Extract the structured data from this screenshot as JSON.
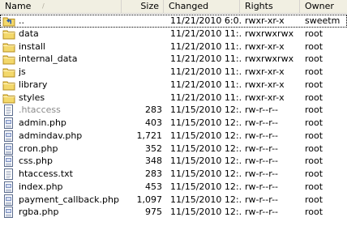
{
  "columns": {
    "name": "Name",
    "size": "Size",
    "changed": "Changed",
    "rights": "Rights",
    "owner": "Owner"
  },
  "sort_indicator": "/",
  "files": [
    {
      "name": "..",
      "size": "",
      "changed": "11/21/2010 6:0...",
      "rights": "rwxr-xr-x",
      "owner": "sweetm",
      "icon": "parent-folder-icon"
    },
    {
      "name": "data",
      "size": "",
      "changed": "11/21/2010 11:...",
      "rights": "rwxrwxrwx",
      "owner": "root",
      "icon": "folder-icon"
    },
    {
      "name": "install",
      "size": "",
      "changed": "11/21/2010 11:...",
      "rights": "rwxr-xr-x",
      "owner": "root",
      "icon": "folder-icon"
    },
    {
      "name": "internal_data",
      "size": "",
      "changed": "11/21/2010 11:...",
      "rights": "rwxrwxrwx",
      "owner": "root",
      "icon": "folder-icon"
    },
    {
      "name": "js",
      "size": "",
      "changed": "11/21/2010 11:...",
      "rights": "rwxr-xr-x",
      "owner": "root",
      "icon": "folder-icon"
    },
    {
      "name": "library",
      "size": "",
      "changed": "11/21/2010 11:...",
      "rights": "rwxr-xr-x",
      "owner": "root",
      "icon": "folder-icon"
    },
    {
      "name": "styles",
      "size": "",
      "changed": "11/21/2010 11:...",
      "rights": "rwxr-xr-x",
      "owner": "root",
      "icon": "folder-icon"
    },
    {
      "name": ".htaccess",
      "size": "283",
      "changed": "11/15/2010 12:...",
      "rights": "rw-r--r--",
      "owner": "root",
      "icon": "text-file-icon",
      "hidden": true
    },
    {
      "name": "admin.php",
      "size": "403",
      "changed": "11/15/2010 12:...",
      "rights": "rw-r--r--",
      "owner": "root",
      "icon": "php-file-icon"
    },
    {
      "name": "admindav.php",
      "size": "1,721",
      "changed": "11/15/2010 12:...",
      "rights": "rw-r--r--",
      "owner": "root",
      "icon": "php-file-icon"
    },
    {
      "name": "cron.php",
      "size": "352",
      "changed": "11/15/2010 12:...",
      "rights": "rw-r--r--",
      "owner": "root",
      "icon": "php-file-icon"
    },
    {
      "name": "css.php",
      "size": "348",
      "changed": "11/15/2010 12:...",
      "rights": "rw-r--r--",
      "owner": "root",
      "icon": "php-file-icon"
    },
    {
      "name": "htaccess.txt",
      "size": "283",
      "changed": "11/15/2010 12:...",
      "rights": "rw-r--r--",
      "owner": "root",
      "icon": "text-file-icon"
    },
    {
      "name": "index.php",
      "size": "453",
      "changed": "11/15/2010 12:...",
      "rights": "rw-r--r--",
      "owner": "root",
      "icon": "php-file-icon"
    },
    {
      "name": "payment_callback.php",
      "size": "1,097",
      "changed": "11/15/2010 12:...",
      "rights": "rw-r--r--",
      "owner": "root",
      "icon": "php-file-icon"
    },
    {
      "name": "rgba.php",
      "size": "975",
      "changed": "11/15/2010 12:...",
      "rights": "rw-r--r--",
      "owner": "root",
      "icon": "php-file-icon"
    }
  ],
  "colors": {
    "folder_fill": "#f3d86b",
    "folder_stroke": "#b58d1e",
    "parent_arrow": "#2a5db0",
    "file_stroke": "#5a6b8c",
    "hidden_text": "#8a8a8a"
  }
}
